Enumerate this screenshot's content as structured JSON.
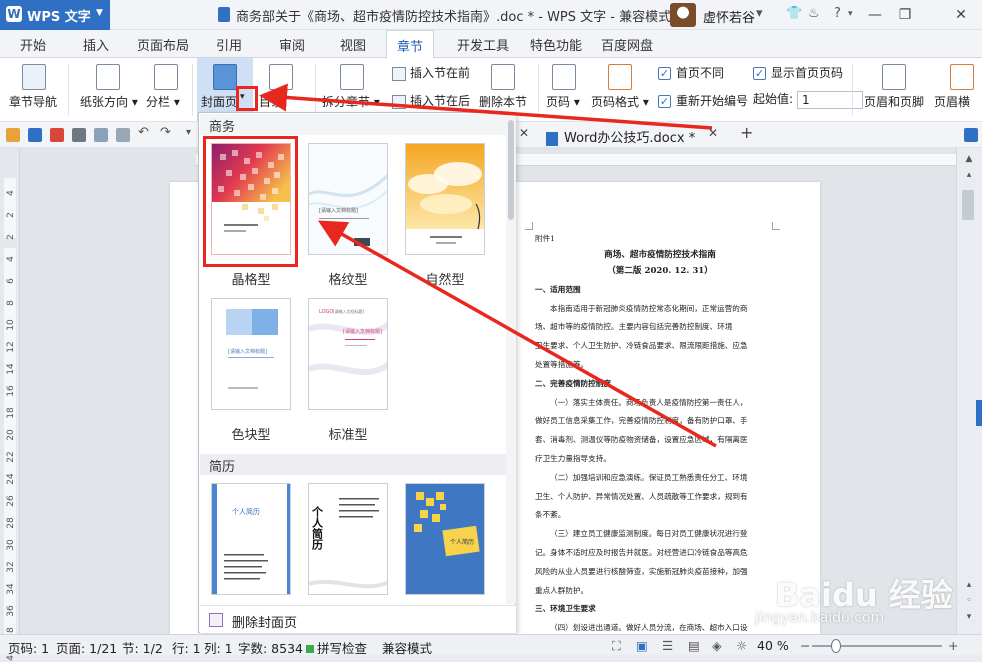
{
  "app": {
    "brand": "WPS 文字",
    "window_title": "商务部关于《商场、超市疫情防控技术指南》.doc * - WPS 文字 - 兼容模式",
    "user": "虚怀若谷"
  },
  "menu_tabs": [
    "开始",
    "插入",
    "页面布局",
    "引用",
    "审阅",
    "视图",
    "章节",
    "开发工具",
    "特色功能",
    "百度网盘"
  ],
  "active_tab": "章节",
  "ribbon": {
    "section_nav": "章节导航",
    "paper_orientation": "纸张方向",
    "columns": "分栏",
    "cover_page": "封面页",
    "toc": "目录",
    "split_chapter": "拆分章节",
    "insert_before": "插入节在前",
    "insert_after": "插入节在后",
    "delete_section": "删除本节",
    "page_number": "页码",
    "page_number_format": "页码格式",
    "diff_first_page": "首页不同",
    "show_first_page_number": "显示首页页码",
    "restart_numbering": "重新开始编号",
    "start_value_label": "起始值:",
    "start_value": "1",
    "header_footer": "页眉和页脚",
    "header_cut": "页眉横"
  },
  "doc_tabs": [
    "Word办公技巧.docx *"
  ],
  "dropdown": {
    "category_business": "商务",
    "category_resume": "简历",
    "templates": [
      "晶格型",
      "格纹型",
      "自然型",
      "色块型",
      "标准型"
    ],
    "resume_texts": [
      "个人简历",
      "个人简历",
      "个人简历"
    ],
    "thumb_title": "[请输入文档标题]",
    "logo": "LOGO",
    "delete_cover": "删除封面页"
  },
  "document": {
    "annex": "附件1",
    "title": "商场、超市疫情防控技术指南",
    "edition": "（第二版 2020. 12. 31）",
    "lines": [
      {
        "t": "一、适用范围",
        "bold": true,
        "indent": false
      },
      {
        "t": "本指南适用于新冠肺炎疫情防控常态化期间，正常运营的商",
        "bold": false,
        "indent": true
      },
      {
        "t": "场、超市等的疫情防控。主要内容包括完善防控制度、环境",
        "bold": false,
        "indent": false
      },
      {
        "t": "卫生要求、个人卫生防护、冷链食品要求、限流限距措施、应急",
        "bold": false,
        "indent": false
      },
      {
        "t": "处置等措施等。",
        "bold": false,
        "indent": false
      },
      {
        "t": "二、完善疫情防控制度",
        "bold": true,
        "indent": false
      },
      {
        "t": "（一）落实主体责任。商场负责人是疫情防控第一责任人，",
        "bold": false,
        "indent": true
      },
      {
        "t": "做好员工信息采集工作，完善疫情防控制度，备有防护口罩、手",
        "bold": false,
        "indent": false
      },
      {
        "t": "套、消毒剂、测温仪等防疫物资储备，设置应急区域，有隔离医",
        "bold": false,
        "indent": false
      },
      {
        "t": "疗卫生力量指导支持。",
        "bold": false,
        "indent": false
      },
      {
        "t": "（二）加强培训和应急演练。保证员工熟悉责任分工、环境",
        "bold": false,
        "indent": true
      },
      {
        "t": "卫生、个人防护、异常情况处置、人员疏散等工作要求，规到有",
        "bold": false,
        "indent": false
      },
      {
        "t": "条不紊。",
        "bold": false,
        "indent": false
      },
      {
        "t": "（三）建立员工健康监测制度。每日对员工健康状况进行登",
        "bold": false,
        "indent": true
      },
      {
        "t": "记。身体不适时应及时报告并就医。对经营进口冷链食品等高危",
        "bold": false,
        "indent": false
      },
      {
        "t": "风险的从业人员要进行核酸筛查，实施新冠肺炎疫苗接种，加强",
        "bold": false,
        "indent": false
      },
      {
        "t": "重点人群防护。",
        "bold": false,
        "indent": false
      },
      {
        "t": "三、环境卫生要求",
        "bold": true,
        "indent": false
      },
      {
        "t": "（四）划设进出通道。做好人员分流，在商场、超市入口设",
        "bold": false,
        "indent": true
      }
    ]
  },
  "ruler_ticks": [
    "4",
    "2",
    "2",
    "4",
    "6",
    "8",
    "10",
    "12",
    "14",
    "16",
    "18",
    "20",
    "22",
    "24",
    "26",
    "28",
    "30",
    "32",
    "34",
    "36",
    "38",
    "40"
  ],
  "status": {
    "page": "页码: 1",
    "pages": "页面: 1/21",
    "section": "节: 1/2",
    "row": "行: 1",
    "col": "列: 1",
    "words": "字数: 8534",
    "spellcheck": "拼写检查",
    "compat": "兼容模式",
    "zoom": "40 %"
  },
  "watermark": {
    "brand": "Baidu 经验",
    "url": "jingyan.baidu.com"
  },
  "colors": {
    "accent": "#2f6fc4",
    "annotation_red": "#e8281e"
  }
}
